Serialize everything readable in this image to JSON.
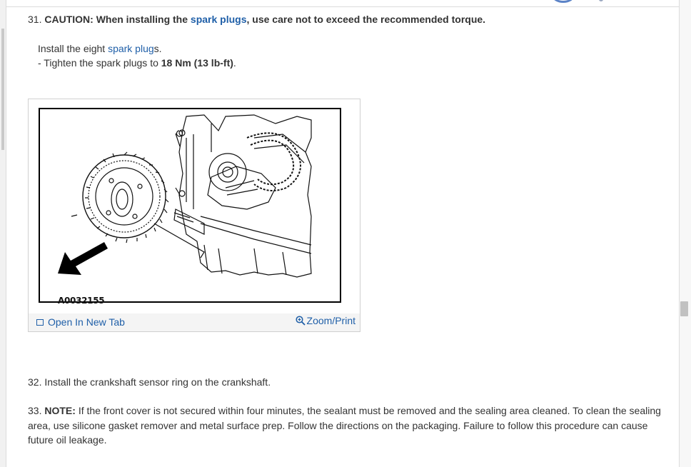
{
  "steps": [
    {
      "number": "31.",
      "caution_label": "CAUTION:",
      "caution_pre": "When installing the",
      "caution_link": "spark plugs",
      "caution_post": ", use care not to exceed the recommended torque.",
      "instruction_pre": "Install the eight",
      "instruction_link": "spark plug",
      "instruction_post": "s.",
      "substep_pre": "-  Tighten the spark plugs to",
      "substep_value": "18 Nm (13 lb-ft)",
      "substep_post": "."
    },
    {
      "number": "32.",
      "text": "Install the crankshaft sensor ring on the crankshaft."
    },
    {
      "number": "33.",
      "note_label": "NOTE:",
      "text": "If the front cover is not secured within four minutes, the sealant must be removed and the sealing area cleaned. To clean the sealing area, use silicone gasket remover and metal surface prep. Follow the directions on the packaging. Failure to follow this procedure can cause future oil leakage."
    }
  ],
  "figure": {
    "code": "A0032155",
    "open_tab_label": "Open In New Tab",
    "zoom_label": "Zoom/Print",
    "icons": [
      "open-tab-icon",
      "zoom-icon"
    ]
  },
  "colors": {
    "link": "#1f5fa8",
    "text": "#333333",
    "footer_bg": "#f4f4f4"
  }
}
